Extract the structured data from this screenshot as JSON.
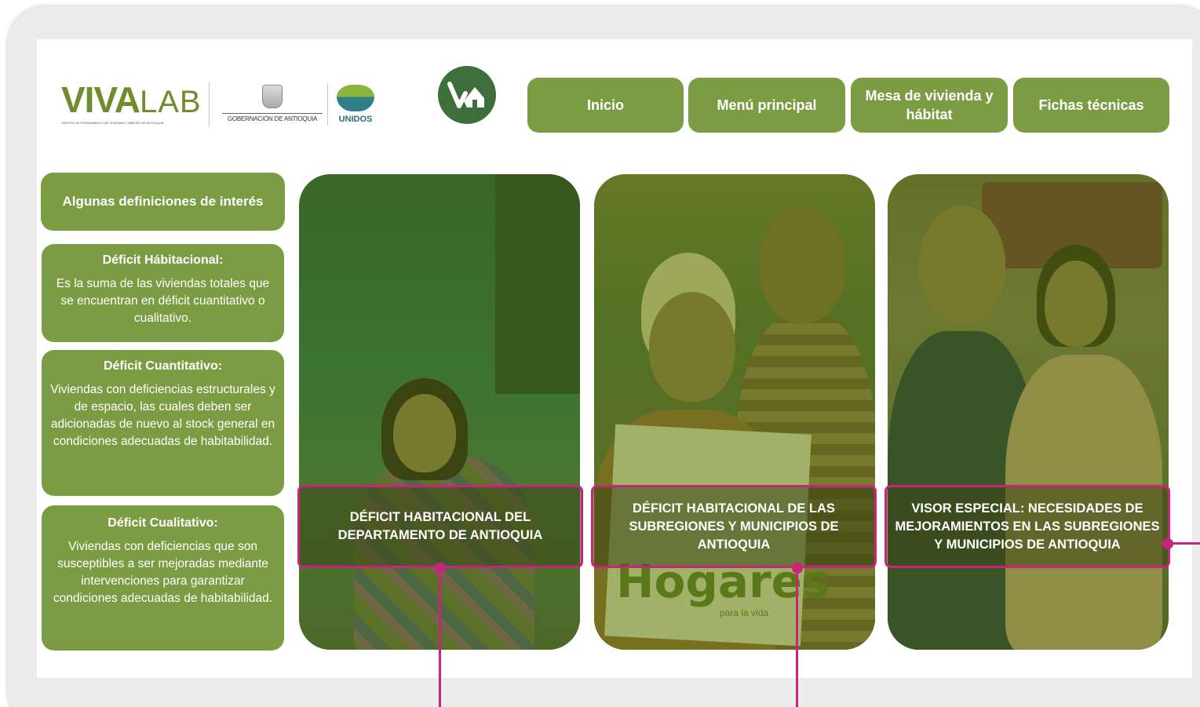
{
  "logos": {
    "vivalab_mark": "VIVA",
    "vivalab_lab": "LAB",
    "vivalab_tagline": "CENTRO DE PENSAMIENTO DE VIVIENDA Y HÁBITAT DE ANTIOQUIA",
    "gobernacion": "GOBERNACIÓN DE ANTIOQUIA",
    "unidos": "UNIDOS"
  },
  "nav": {
    "inicio": "Inicio",
    "menu_principal": "Menú principal",
    "mesa_vivienda": "Mesa de vivienda y hábitat",
    "fichas_tecnicas": "Fichas técnicas"
  },
  "definitions": {
    "title": "Algunas definiciones de interés",
    "items": [
      {
        "heading": "Déficit Hábitacional:",
        "body": "Es la suma de las viviendas totales que se encuentran en déficit cuantitativo o cualitativo."
      },
      {
        "heading": "Déficit Cuantitativo:",
        "body": "Viviendas con deficiencias estructurales y de espacio, las cuales deben ser adicionadas de nuevo al stock general en condiciones adecuadas de habitabilidad."
      },
      {
        "heading": "Déficit Cualitativo:",
        "body": "Viviendas con deficiencias que son susceptibles a ser mejoradas mediante intervenciones para garantizar condiciones adecuadas de habitabilidad."
      }
    ]
  },
  "cards": [
    {
      "label": "DÉFICIT HABITACIONAL DEL DEPARTAMENTO DE ANTIOQUIA"
    },
    {
      "label": "DÉFICIT HABITACIONAL DE LAS SUBREGIONES Y MUNICIPIOS DE ANTIOQUIA",
      "sign_text": "Hogares",
      "sign_sub": "para la vida"
    },
    {
      "label": "VISOR ESPECIAL: NECESIDADES DE MEJORAMIENTOS EN LAS SUBREGIONES Y MUNICIPIOS DE ANTIOQUIA"
    }
  ],
  "colors": {
    "accent_green": "#7c9c44",
    "dark_green": "#3e6f3a",
    "highlight_magenta": "#c8247c"
  }
}
